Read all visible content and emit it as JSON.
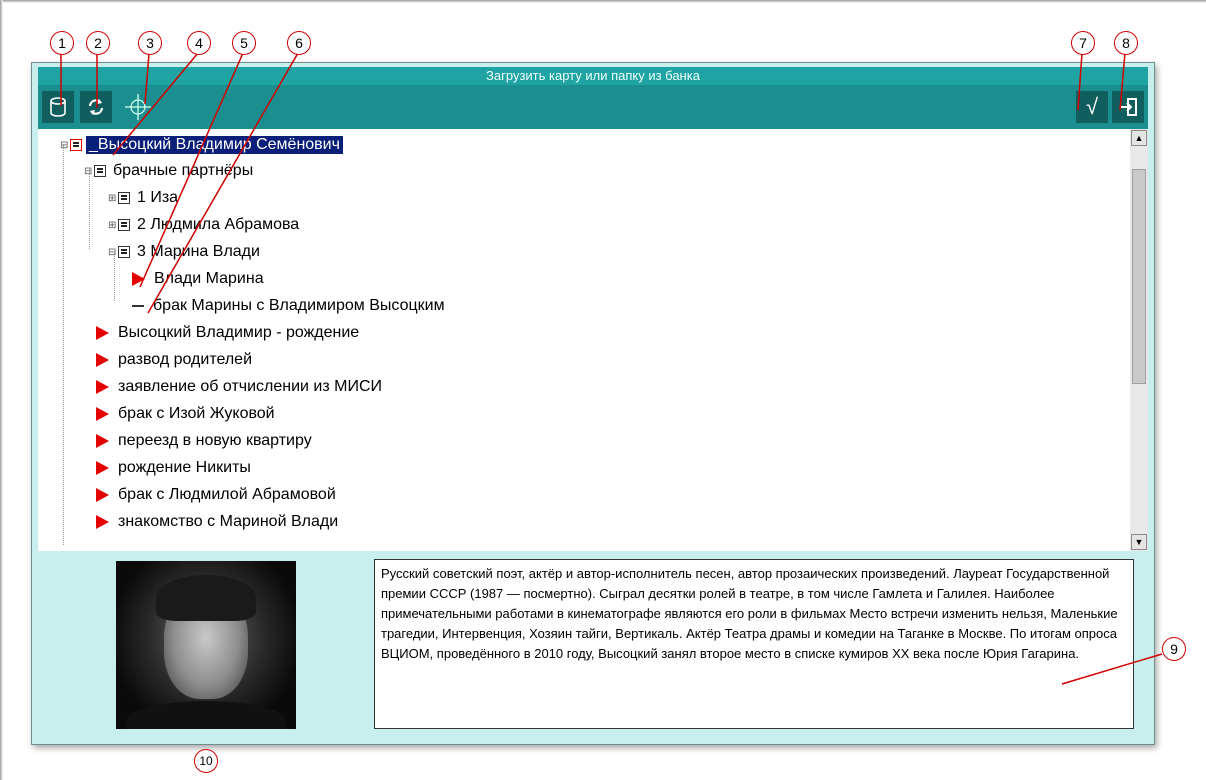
{
  "window": {
    "title": "Загрузить карту или папку из банка"
  },
  "toolbar": {
    "left_buttons": [
      {
        "icon": "cylinder-icon"
      },
      {
        "icon": "refresh-icon"
      },
      {
        "icon": "crosshair-icon"
      }
    ],
    "right_buttons": [
      {
        "icon": "checkmark-icon",
        "label": "√"
      },
      {
        "icon": "exit-icon"
      }
    ]
  },
  "tree": {
    "root": "_Высоцкий Владимир Семёнович",
    "folder": "брачные партнёры",
    "partners": [
      "1 Иза",
      "2 Людмила Абрамова",
      "3 Марина Влади"
    ],
    "marina_children": [
      "Влади Марина",
      "брак Марины с Владимиром Высоцким"
    ],
    "events": [
      "Высоцкий Владимир - рождение",
      "развод родителей",
      "заявление об отчислении из МИСИ",
      "брак с Изой Жуковой",
      "переезд в новую квартиру",
      "рождение Никиты",
      "брак с Людмилой Абрамовой",
      "знакомство с Мариной Влади"
    ]
  },
  "description": "Русский советский поэт, актёр и автор-исполнитель песен, автор прозаических произведений. Лауреат Государственной премии СССР (1987 — посмертно). Сыграл десятки ролей в театре, в том числе Гамлета и Галилея. Наиболее примечательными работами в кинематографе являются его роли в фильмах Место встречи изменить нельзя, Маленькие трагедии, Интервенция, Хозяин тайги, Вертикаль. Актёр Театра драмы и комедии на Таганке в Москве.  По итогам опроса ВЦИОМ, проведённого в 2010 году, Высоцкий занял второе место в списке кумиров XX века после Юрия Гагарина.",
  "callouts": [
    "1",
    "2",
    "3",
    "4",
    "5",
    "6",
    "7",
    "8",
    "9",
    "10"
  ],
  "colors": {
    "titlebar": "#1fa3a3",
    "toolbar": "#1b8f8f",
    "panel": "#c8eeee",
    "selection": "#0a1f7a",
    "event_arrow": "#e50000",
    "callout_ring": "#d20000"
  }
}
